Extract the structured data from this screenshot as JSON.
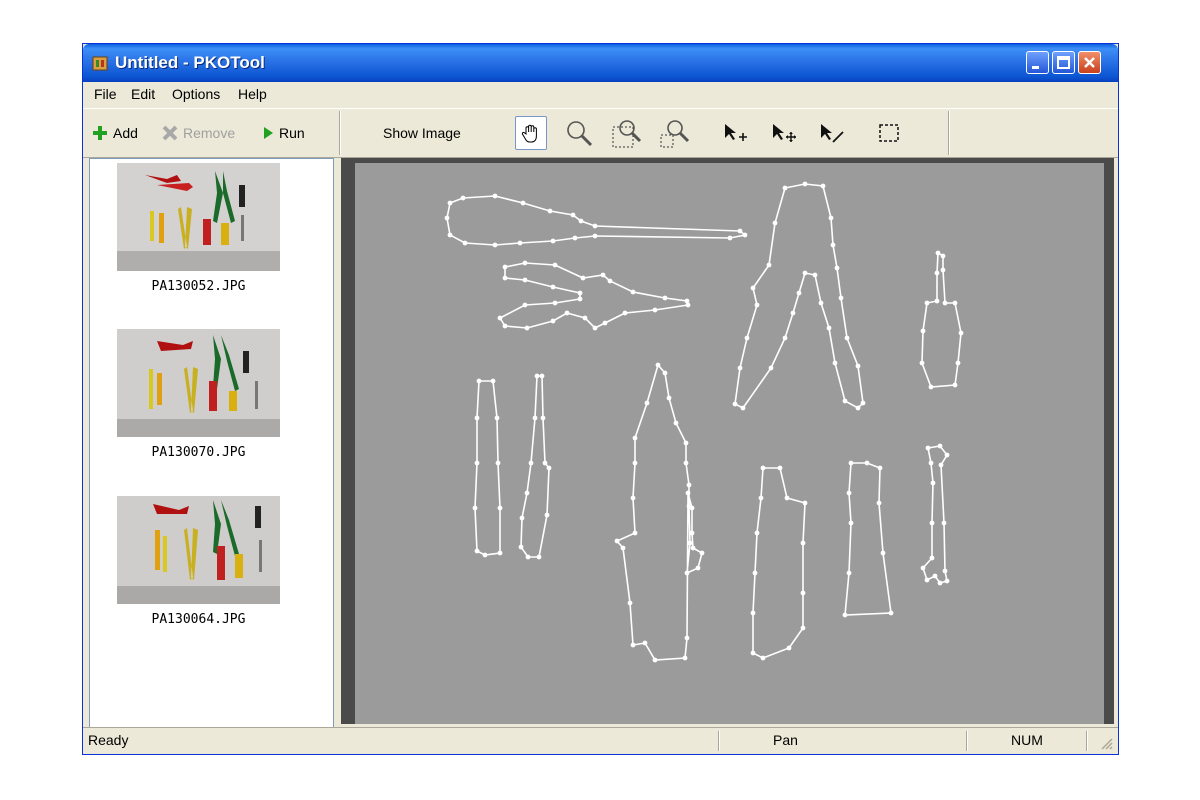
{
  "window": {
    "title": "Untitled - PKOTool"
  },
  "menu": [
    "File",
    "Edit",
    "Options",
    "Help"
  ],
  "toolbar": {
    "add_label": "Add",
    "remove_label": "Remove",
    "run_label": "Run",
    "show_image_label": "Show Image",
    "tools": [
      "hand-pan-icon",
      "zoom-icon",
      "zoom-region-icon",
      "zoom-out-icon",
      "add-point-icon",
      "move-point-icon",
      "edit-point-icon",
      "select-region-icon"
    ]
  },
  "thumbnails": [
    {
      "caption": "PA130052.JPG"
    },
    {
      "caption": "PA130070.JPG"
    },
    {
      "caption": "PA130064.JPG"
    }
  ],
  "status": {
    "left": "Ready",
    "mode": "Pan",
    "num": "NUM"
  },
  "colors": {
    "title_bar": "#2a72e6",
    "canvas_bg": "#9b9b9b",
    "outline": "#ffffff"
  }
}
